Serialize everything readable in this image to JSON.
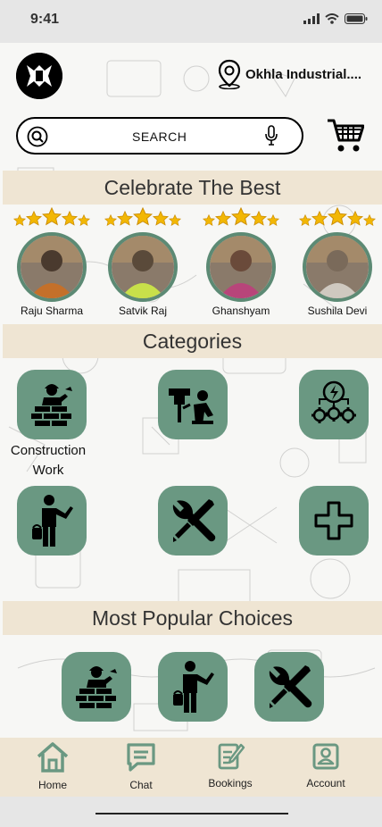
{
  "status": {
    "time": "9:41"
  },
  "header": {
    "location": "Okhla Industrial....",
    "search_placeholder": "SEARCH"
  },
  "celebrate": {
    "title": "Celebrate The Best",
    "workers": [
      {
        "name": "Raju Sharma",
        "rating": 5
      },
      {
        "name": "Satvik Raj",
        "rating": 5
      },
      {
        "name": "Ghanshyam",
        "rating": 5
      },
      {
        "name": "Sushila Devi",
        "rating": 5
      }
    ]
  },
  "categories": {
    "title": "Categories",
    "items": [
      {
        "icon": "bricklayer-icon",
        "label": "Construction Work"
      },
      {
        "icon": "plumber-icon",
        "label": ""
      },
      {
        "icon": "electrical-gears-icon",
        "label": ""
      },
      {
        "icon": "painter-icon",
        "label": ""
      },
      {
        "icon": "wrench-screwdriver-icon",
        "label": ""
      },
      {
        "icon": "plus-icon",
        "label": ""
      }
    ]
  },
  "popular": {
    "title": "Most Popular Choices",
    "items": [
      {
        "icon": "bricklayer-icon"
      },
      {
        "icon": "painter-icon"
      },
      {
        "icon": "wrench-screwdriver-icon"
      }
    ]
  },
  "nav": {
    "items": [
      {
        "label": "Home",
        "icon": "home-icon"
      },
      {
        "label": "Chat",
        "icon": "chat-icon"
      },
      {
        "label": "Bookings",
        "icon": "bookings-icon"
      },
      {
        "label": "Account",
        "icon": "account-icon"
      }
    ]
  },
  "colors": {
    "accent": "#6a9882",
    "band": "#efe5d3",
    "star": "#f2b705"
  }
}
